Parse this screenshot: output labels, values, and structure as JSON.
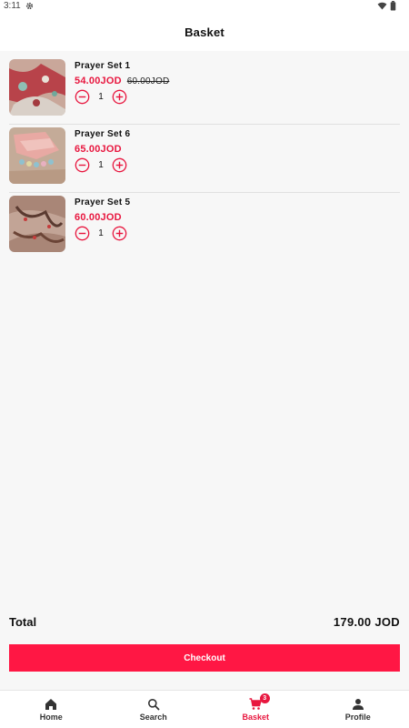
{
  "status_bar": {
    "time": "3:11"
  },
  "header": {
    "title": "Basket"
  },
  "items": [
    {
      "name": "Prayer Set 1",
      "price": "54.00JOD",
      "old_price": "60.00JOD",
      "quantity": "1"
    },
    {
      "name": "Prayer Set 6",
      "price": "65.00JOD",
      "old_price": "",
      "quantity": "1"
    },
    {
      "name": "Prayer Set 5",
      "price": "60.00JOD",
      "old_price": "",
      "quantity": "1"
    }
  ],
  "summary": {
    "total_label": "Total",
    "total_value": "179.00 JOD"
  },
  "checkout": {
    "label": "Checkout"
  },
  "nav": {
    "home": "Home",
    "search": "Search",
    "basket": "Basket",
    "basket_badge": "3",
    "profile": "Profile"
  },
  "colors": {
    "accent": "#ff1744",
    "price": "#e8173f",
    "background": "#f7f7f7"
  },
  "icons": [
    "settings-icon",
    "wifi-icon",
    "battery-icon",
    "minus-circle-icon",
    "plus-circle-icon",
    "home-icon",
    "search-icon",
    "cart-icon",
    "person-icon"
  ]
}
